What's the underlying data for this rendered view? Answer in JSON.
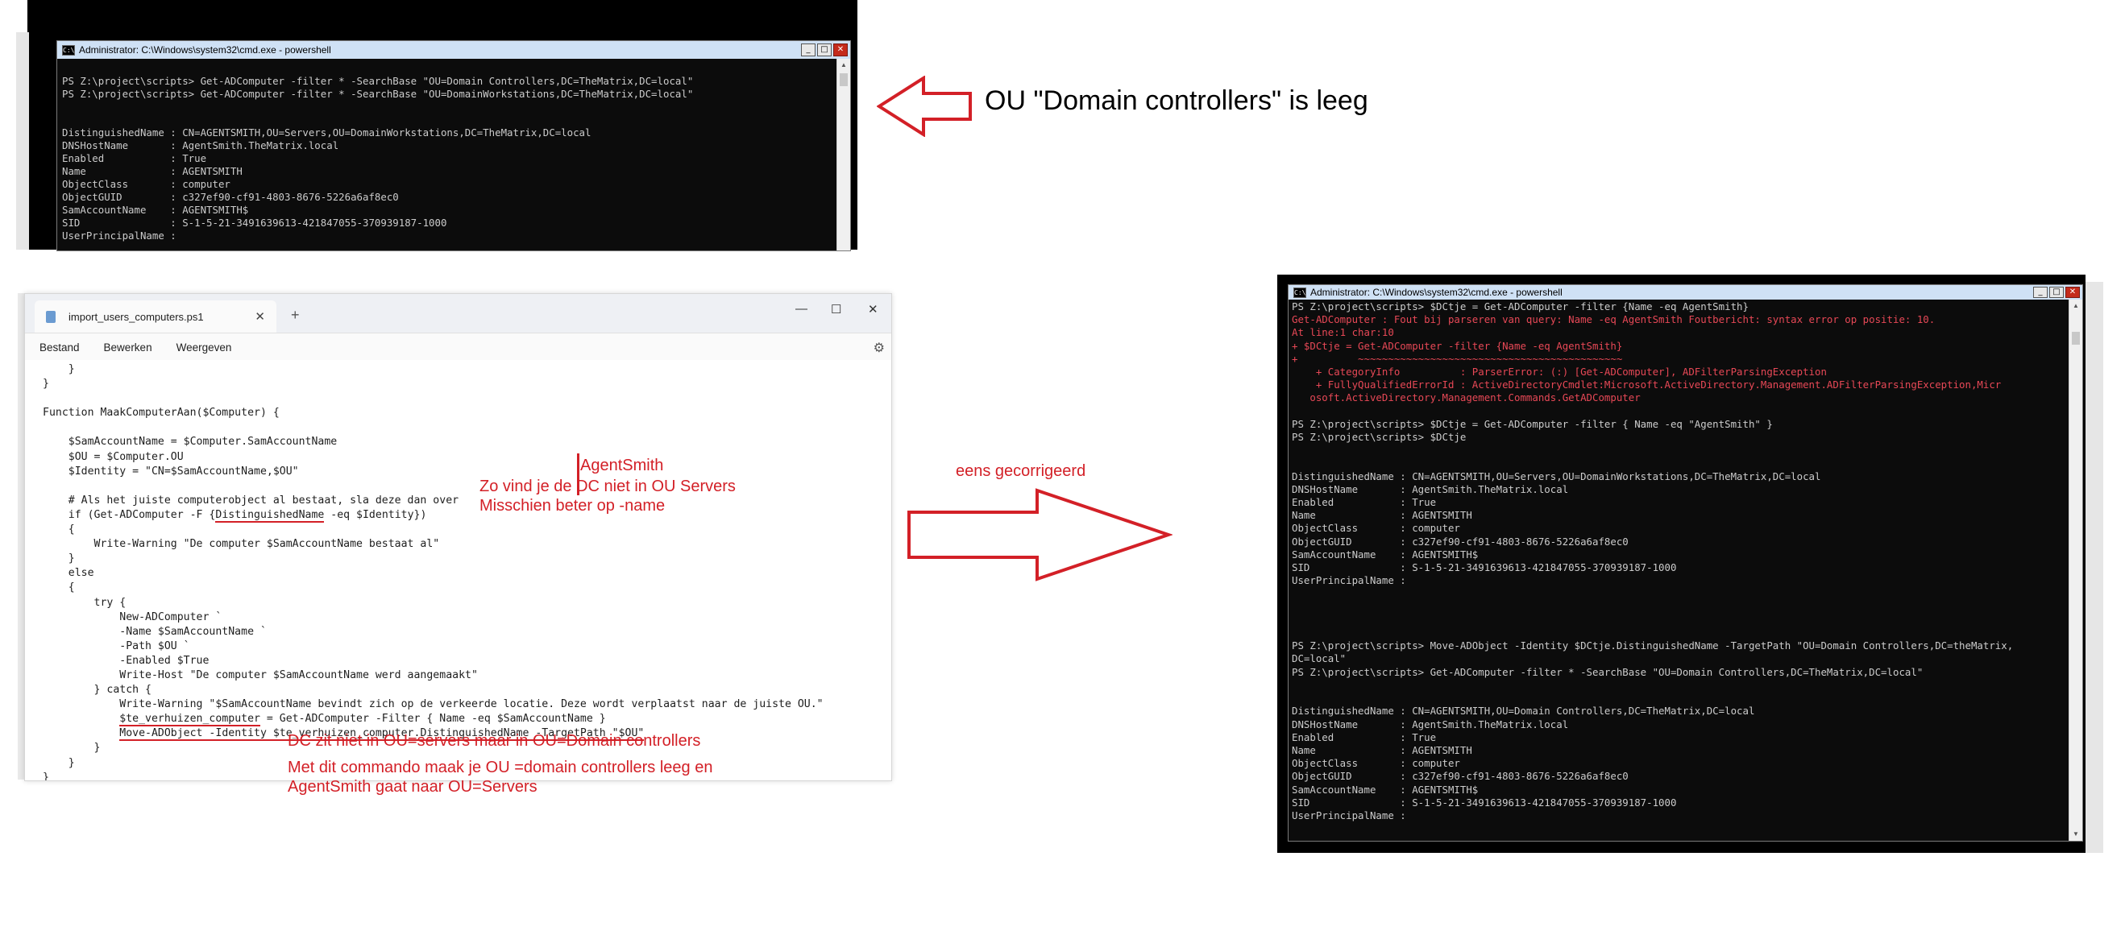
{
  "top_console": {
    "title": "Administrator: C:\\Windows\\system32\\cmd.exe - powershell",
    "lines": [
      "",
      "PS Z:\\project\\scripts> Get-ADComputer -filter * -SearchBase \"OU=Domain Controllers,DC=TheMatrix,DC=local\"",
      "PS Z:\\project\\scripts> Get-ADComputer -filter * -SearchBase \"OU=DomainWorkstations,DC=TheMatrix,DC=local\"",
      "",
      "",
      "DistinguishedName : CN=AGENTSMITH,OU=Servers,OU=DomainWorkstations,DC=TheMatrix,DC=local",
      "DNSHostName       : AgentSmith.TheMatrix.local",
      "Enabled           : True",
      "Name              : AGENTSMITH",
      "ObjectClass       : computer",
      "ObjectGUID        : c327ef90-cf91-4803-8676-5226a6af8ec0",
      "SamAccountName    : AGENTSMITH$",
      "SID               : S-1-5-21-3491639613-421847055-370939187-1000",
      "UserPrincipalName :"
    ]
  },
  "top_annotation": "OU \"Domain controllers\" is leeg",
  "notepad": {
    "tab_title": "import_users_computers.ps1",
    "tab_close": "✕",
    "new_tab": "+",
    "window_controls": [
      "—",
      "☐",
      "✕"
    ],
    "menu": [
      "Bestand",
      "Bewerken",
      "Weergeven"
    ],
    "code_lines": [
      "    }",
      "}",
      "",
      "Function MaakComputerAan($Computer) {",
      "",
      "    $SamAccountName = $Computer.SamAccountName",
      "    $OU = $Computer.OU",
      "    $Identity = \"CN=$SamAccountName,$OU\"",
      "",
      "    # Als het juiste computerobject al bestaat, sla deze dan over",
      "    if (Get-ADComputer -F {DistinguishedName -eq $Identity})",
      "    {",
      "        Write-Warning \"De computer $SamAccountName bestaat al\"",
      "    }",
      "    else",
      "    {",
      "        try {",
      "            New-ADComputer `",
      "            -Name $SamAccountName `",
      "            -Path $OU `",
      "            -Enabled $True",
      "            Write-Host \"De computer $SamAccountName werd aangemaakt\"",
      "        } catch {",
      "            Write-Warning \"$SamAccountName bevindt zich op de verkeerde locatie. Deze wordt verplaatst naar de juiste OU.\"",
      "            $te_verhuizen_computer = Get-ADComputer -Filter { Name -eq $SamAccountName }",
      "            Move-ADObject -Identity $te_verhuizen_computer.DistinguishedName -TargetPath \"$OU\"",
      "        }",
      "    }",
      "}"
    ]
  },
  "annotations": {
    "agentsmith": "AgentSmith",
    "zo_vind": "Zo vind je de DC niet in OU Servers",
    "misschien": "Misschien beter op -name",
    "dc_zit": "DC zit niet in OU=servers maar in OU=Domain controllers",
    "met_dit_1": "Met dit commando maak je OU =domain controllers leeg en",
    "met_dit_2": "AgentSmith gaat naar OU=Servers",
    "eens": "eens gecorrigeerd"
  },
  "right_console": {
    "title": "Administrator: C:\\Windows\\system32\\cmd.exe - powershell",
    "lines": [
      {
        "t": "PS Z:\\project\\scripts> $DCtje = Get-ADComputer -filter {Name -eq AgentSmith}",
        "err": false
      },
      {
        "t": "Get-ADComputer : Fout bij parseren van query: Name -eq AgentSmith Foutbericht: syntax error op positie: 10.",
        "err": true
      },
      {
        "t": "At line:1 char:10",
        "err": true
      },
      {
        "t": "+ $DCtje = Get-ADComputer -filter {Name -eq AgentSmith}",
        "err": true
      },
      {
        "t": "+          ~~~~~~~~~~~~~~~~~~~~~~~~~~~~~~~~~~~~~~~~~~~~",
        "err": true
      },
      {
        "t": "    + CategoryInfo          : ParserError: (:) [Get-ADComputer], ADFilterParsingException",
        "err": true
      },
      {
        "t": "    + FullyQualifiedErrorId : ActiveDirectoryCmdlet:Microsoft.ActiveDirectory.Management.ADFilterParsingException,Micr",
        "err": true
      },
      {
        "t": "   osoft.ActiveDirectory.Management.Commands.GetADComputer",
        "err": true
      },
      {
        "t": "",
        "err": false
      },
      {
        "t": "PS Z:\\project\\scripts> $DCtje = Get-ADComputer -filter { Name -eq \"AgentSmith\" }",
        "err": false
      },
      {
        "t": "PS Z:\\project\\scripts> $DCtje",
        "err": false
      },
      {
        "t": "",
        "err": false
      },
      {
        "t": "",
        "err": false
      },
      {
        "t": "DistinguishedName : CN=AGENTSMITH,OU=Servers,OU=DomainWorkstations,DC=TheMatrix,DC=local",
        "err": false
      },
      {
        "t": "DNSHostName       : AgentSmith.TheMatrix.local",
        "err": false
      },
      {
        "t": "Enabled           : True",
        "err": false
      },
      {
        "t": "Name              : AGENTSMITH",
        "err": false
      },
      {
        "t": "ObjectClass       : computer",
        "err": false
      },
      {
        "t": "ObjectGUID        : c327ef90-cf91-4803-8676-5226a6af8ec0",
        "err": false
      },
      {
        "t": "SamAccountName    : AGENTSMITH$",
        "err": false
      },
      {
        "t": "SID               : S-1-5-21-3491639613-421847055-370939187-1000",
        "err": false
      },
      {
        "t": "UserPrincipalName :",
        "err": false
      },
      {
        "t": "",
        "err": false
      },
      {
        "t": "",
        "err": false
      },
      {
        "t": "",
        "err": false
      },
      {
        "t": "",
        "err": false
      },
      {
        "t": "PS Z:\\project\\scripts> Move-ADObject -Identity $DCtje.DistinguishedName -TargetPath \"OU=Domain Controllers,DC=theMatrix,",
        "err": false
      },
      {
        "t": "DC=local\"",
        "err": false
      },
      {
        "t": "PS Z:\\project\\scripts> Get-ADComputer -filter * -SearchBase \"OU=Domain Controllers,DC=TheMatrix,DC=local\"",
        "err": false
      },
      {
        "t": "",
        "err": false
      },
      {
        "t": "",
        "err": false
      },
      {
        "t": "DistinguishedName : CN=AGENTSMITH,OU=Domain Controllers,DC=TheMatrix,DC=local",
        "err": false
      },
      {
        "t": "DNSHostName       : AgentSmith.TheMatrix.local",
        "err": false
      },
      {
        "t": "Enabled           : True",
        "err": false
      },
      {
        "t": "Name              : AGENTSMITH",
        "err": false
      },
      {
        "t": "ObjectClass       : computer",
        "err": false
      },
      {
        "t": "ObjectGUID        : c327ef90-cf91-4803-8676-5226a6af8ec0",
        "err": false
      },
      {
        "t": "SamAccountName    : AGENTSMITH$",
        "err": false
      },
      {
        "t": "SID               : S-1-5-21-3491639613-421847055-370939187-1000",
        "err": false
      },
      {
        "t": "UserPrincipalName :",
        "err": false
      }
    ]
  },
  "colors": {
    "annotation_red": "#d32027",
    "console_bg": "#0c0c0c",
    "console_text": "#cccccc",
    "console_error": "#e74856"
  }
}
